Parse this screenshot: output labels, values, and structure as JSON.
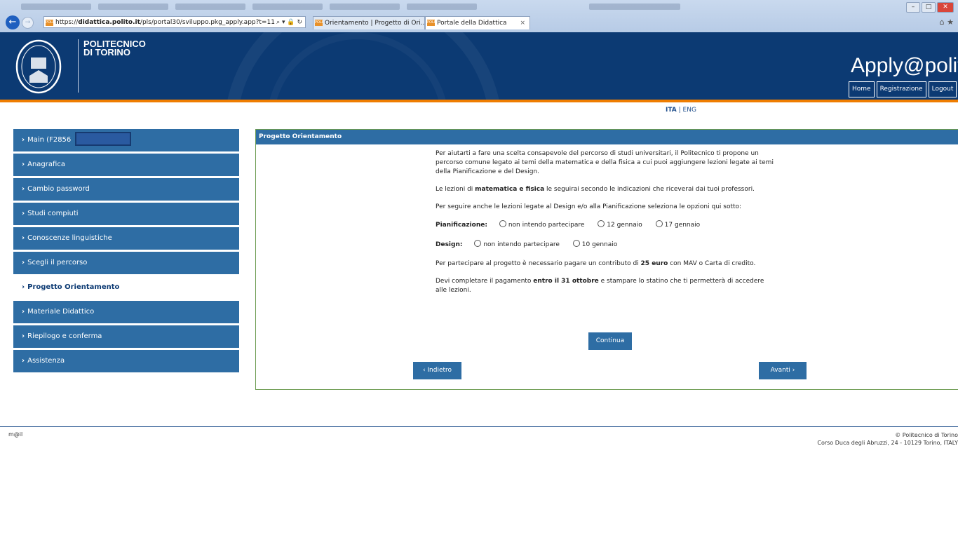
{
  "browser": {
    "url_prefix": "https://",
    "url_domain": "didattica.polito.it",
    "url_path": "/pls/portal30/sviluppo.pkg_apply.app?t=11",
    "tabs": [
      {
        "label": "Orientamento | Progetto di Ori..."
      },
      {
        "label": "Portale della Didattica"
      }
    ]
  },
  "header": {
    "brand_line1": "POLITECNICO",
    "brand_line2": "DI TORINO",
    "app_title": "Apply@polito",
    "nav": [
      "Home",
      "Registrazione",
      "Logout"
    ]
  },
  "lang": {
    "ita": "ITA",
    "sep": " | ",
    "eng": "ENG"
  },
  "sidebar": {
    "items": [
      {
        "label": "Main (F2856"
      },
      {
        "label": "Anagrafica"
      },
      {
        "label": "Cambio password"
      },
      {
        "label": "Studi compiuti"
      },
      {
        "label": "Conoscenze linguistiche"
      },
      {
        "label": "Scegli il percorso"
      },
      {
        "label": "Progetto Orientamento"
      },
      {
        "label": "Materiale Didattico"
      },
      {
        "label": "Riepilogo e conferma"
      },
      {
        "label": "Assistenza"
      }
    ]
  },
  "panel": {
    "title": "Progetto Orientamento",
    "intro": "Per aiutarti a fare una scelta consapevole del percorso di studi universitari, il Politecnico ti propone un percorso comune legato ai temi della matematica e della fisica a cui puoi aggiungere lezioni legate ai temi della Pianificazione e del Design.",
    "lessons_pre": "Le lezioni di ",
    "lessons_bold": "matematica e fisica",
    "lessons_post": " le seguirai secondo le indicazioni che riceverai dai tuoi professori.",
    "select_text": "Per seguire anche le lezioni legate al Design e/o alla Pianificazione seleziona le opzioni qui sotto:",
    "pianificazione": {
      "label": "Pianificazione:",
      "options": [
        "non intendo partecipare",
        "12 gennaio",
        "17 gennaio"
      ]
    },
    "design": {
      "label": "Design:",
      "options": [
        "non intendo partecipare",
        "10 gennaio"
      ]
    },
    "fee_pre": "Per partecipare al progetto è necessario pagare un contributo di ",
    "fee_bold": "25 euro",
    "fee_post": " con MAV o Carta di credito.",
    "deadline_pre": "Devi completare il pagamento ",
    "deadline_bold": "entro il 31 ottobre",
    "deadline_post": " e stampare lo statino che ti permetterà di accedere alle lezioni.",
    "continue_label": "Continua",
    "back_label": "Indietro",
    "next_label": "Avanti"
  },
  "footer": {
    "mail": "m@il",
    "copyright": "© Politecnico di Torino",
    "address": "Corso Duca degli Abruzzi, 24 - 10129 Torino, ITALY"
  }
}
